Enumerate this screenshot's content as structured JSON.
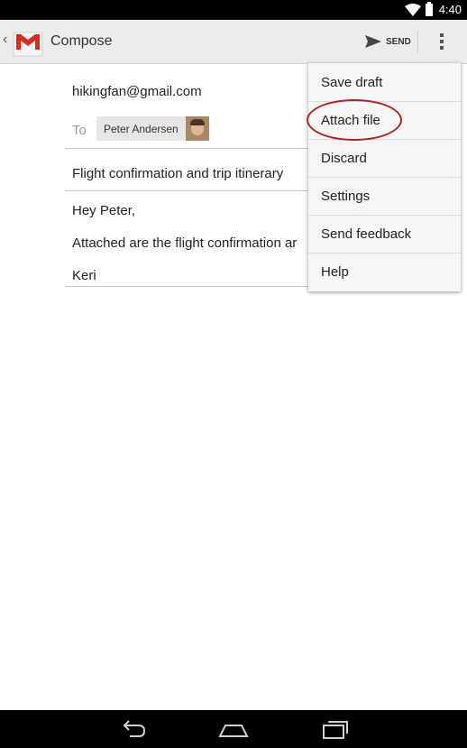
{
  "status_bar": {
    "time": "4:40"
  },
  "action_bar": {
    "icon": "gmail-logo",
    "title": "Compose",
    "send_label": "SEND",
    "send_icon": "send-arrow-icon",
    "overflow_icon": "overflow-menu-icon"
  },
  "compose": {
    "from": "hikingfan@gmail.com",
    "to_label": "To",
    "recipient": {
      "name": "Peter Andersen",
      "avatar": "contact-photo"
    },
    "subject": "Flight confirmation and trip itinerary",
    "body_lines": [
      "Hey Peter,",
      "Attached are the flight confirmation ar",
      "Keri"
    ]
  },
  "overflow_menu": {
    "items": [
      {
        "label": "Save draft"
      },
      {
        "label": "Attach file",
        "highlighted": true
      },
      {
        "label": "Discard"
      },
      {
        "label": "Settings"
      },
      {
        "label": "Send feedback"
      },
      {
        "label": "Help"
      }
    ],
    "highlight_color": "#b22222"
  },
  "nav_bar": {
    "back_icon": "back-icon",
    "home_icon": "home-icon",
    "recents_icon": "recent-apps-icon"
  }
}
